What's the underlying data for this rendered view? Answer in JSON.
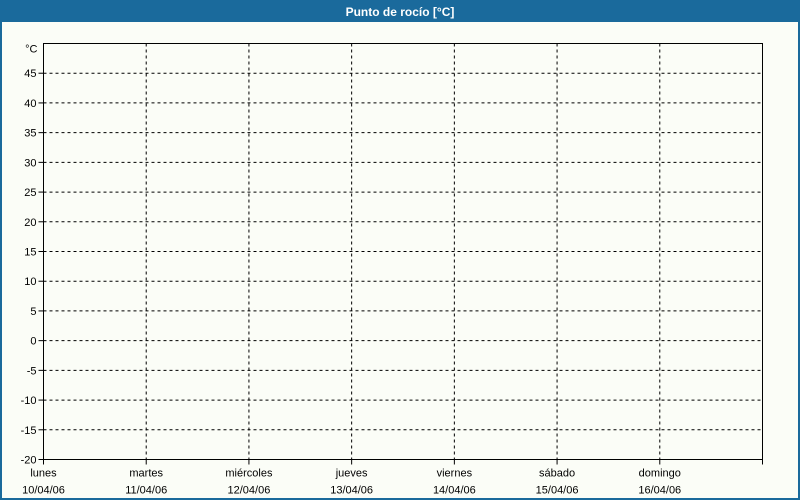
{
  "window": {
    "title": "Punto de rocío [°C]"
  },
  "colors": {
    "frame": "#1a6a9c",
    "title_text": "#ffffff",
    "background": "#fbfdf7",
    "grid": "#000000",
    "axis": "#000000",
    "label_text": "#000000"
  },
  "chart_data": {
    "type": "line",
    "title": "Punto de rocío [°C]",
    "grid": {
      "style": "dashed",
      "horizontal_step_degC": 5,
      "vertical_step_days": 1
    },
    "legend": "none",
    "y_axis": {
      "unit_label": "°C",
      "min": -20,
      "max": 50,
      "tick_step": 5,
      "tick_labels": [
        "45",
        "40",
        "35",
        "30",
        "25",
        "20",
        "15",
        "10",
        "5",
        "0",
        "-5",
        "-10",
        "-15",
        "-20"
      ],
      "tick_values": [
        45,
        40,
        35,
        30,
        25,
        20,
        15,
        10,
        5,
        0,
        -5,
        -10,
        -15,
        -20
      ]
    },
    "x_axis": {
      "days": [
        {
          "name": "lunes",
          "date": "10/04/06"
        },
        {
          "name": "martes",
          "date": "11/04/06"
        },
        {
          "name": "miércoles",
          "date": "12/04/06"
        },
        {
          "name": "jueves",
          "date": "13/04/06"
        },
        {
          "name": "viernes",
          "date": "14/04/06"
        },
        {
          "name": "sábado",
          "date": "15/04/06"
        },
        {
          "name": "domingo",
          "date": "16/04/06"
        }
      ]
    },
    "series": []
  }
}
